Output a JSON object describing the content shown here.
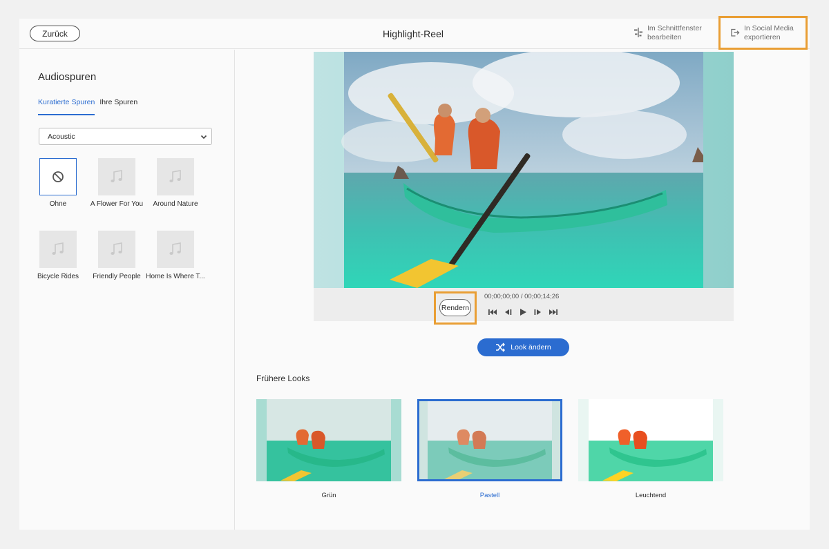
{
  "header": {
    "back_label": "Zurück",
    "title": "Highlight-Reel",
    "edit_timeline_line1": "Im Schnittfenster",
    "edit_timeline_line2": "bearbeiten",
    "export_line1": "In Social Media",
    "export_line2": "exportieren"
  },
  "audio": {
    "title": "Audiospuren",
    "tabs": [
      {
        "label": "Kuratierte Spuren",
        "active": true
      },
      {
        "label": "Ihre Spuren",
        "active": false
      }
    ],
    "genre_selected": "Acoustic",
    "tracks": [
      {
        "label": "Ohne",
        "selected": true
      },
      {
        "label": "A Flower For You",
        "selected": false
      },
      {
        "label": "Around Nature",
        "selected": false
      },
      {
        "label": "Bicycle Rides",
        "selected": false
      },
      {
        "label": "Friendly People",
        "selected": false
      },
      {
        "label": "Home Is Where T...",
        "selected": false
      }
    ]
  },
  "player": {
    "render_label": "Rendern",
    "timecode": "00;00;00;00 / 00;00;14;26"
  },
  "look_button_label": "Look ändern",
  "earlier_looks": {
    "title": "Frühere Looks",
    "items": [
      {
        "label": "Grün",
        "selected": false
      },
      {
        "label": "Pastell",
        "selected": true
      },
      {
        "label": "Leuchtend",
        "selected": false
      }
    ]
  },
  "colors": {
    "accent": "#2b6cd0",
    "highlight": "#e99e34"
  }
}
